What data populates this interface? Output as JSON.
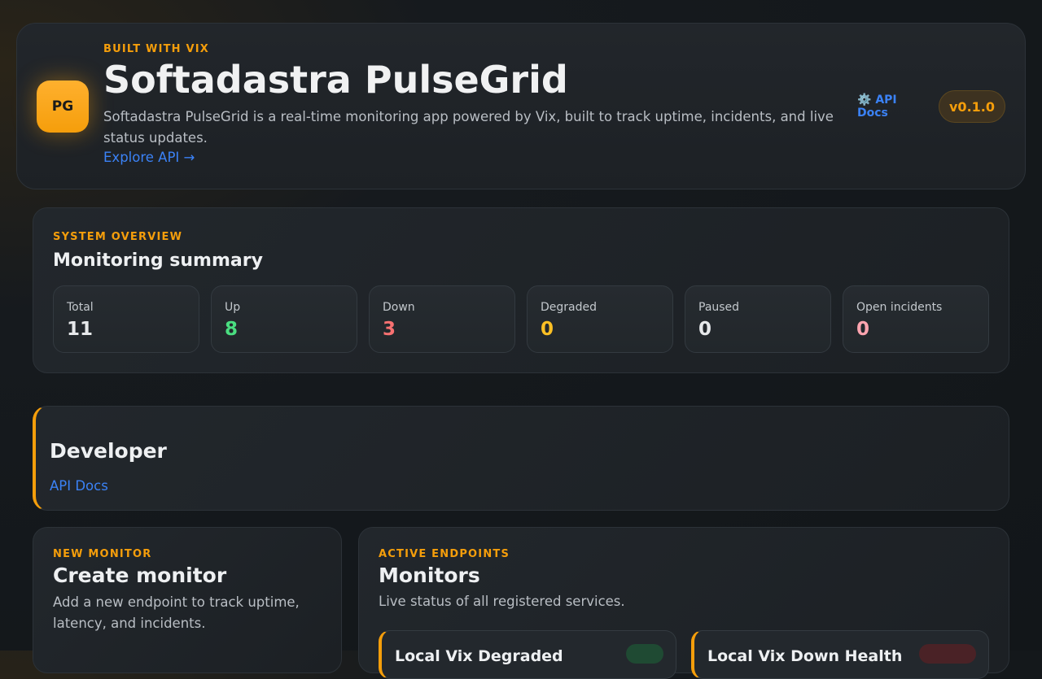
{
  "header": {
    "logo_text": "PG",
    "eyebrow": "BUILT WITH VIX",
    "title": "Softadastra PulseGrid",
    "description": "Softadastra PulseGrid is a real-time monitoring app powered by Vix, built to track uptime, incidents, and live status updates.",
    "explore_link": "Explore API →",
    "api_docs_icon": "gear-icon",
    "api_docs_glyph": "⚙️",
    "api_docs_label": "API Docs",
    "version": "v0.1.0"
  },
  "overview": {
    "eyebrow": "SYSTEM OVERVIEW",
    "title": "Monitoring summary",
    "stats": [
      {
        "label": "Total",
        "value": "11",
        "color": "#e6e8ea"
      },
      {
        "label": "Up",
        "value": "8",
        "color": "#4ade80"
      },
      {
        "label": "Down",
        "value": "3",
        "color": "#f87171"
      },
      {
        "label": "Degraded",
        "value": "0",
        "color": "#fbbf24"
      },
      {
        "label": "Paused",
        "value": "0",
        "color": "#e6e8ea"
      },
      {
        "label": "Open incidents",
        "value": "0",
        "color": "#fda4af"
      }
    ]
  },
  "developer": {
    "title": "Developer",
    "link": "API Docs"
  },
  "create": {
    "eyebrow": "NEW MONITOR",
    "title": "Create monitor",
    "subtitle": "Add a new endpoint to track uptime, latency, and incidents."
  },
  "monitors": {
    "eyebrow": "ACTIVE ENDPOINTS",
    "title": "Monitors",
    "subtitle": "Live status of all registered services.",
    "items": [
      {
        "name": "Local Vix Degraded",
        "status_color": "#1f4a33"
      },
      {
        "name": "Local Vix Down Health",
        "status_color": "#4a2226"
      }
    ]
  },
  "colors": {
    "accent": "#f59e0b",
    "link": "#3b82f6"
  }
}
